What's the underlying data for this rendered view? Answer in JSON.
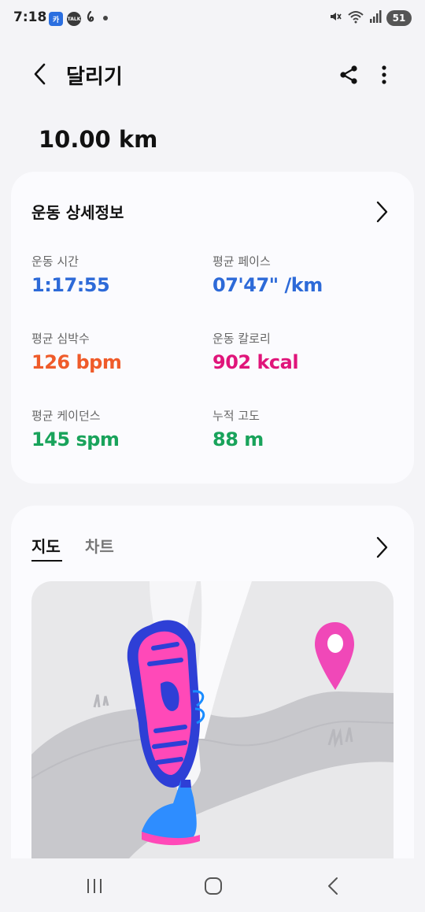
{
  "status_bar": {
    "time": "7:18",
    "notification_icons": [
      "kakao-page-icon",
      "kakaotalk-icon",
      "app-icon",
      "dot-icon"
    ],
    "kakao_page_label": "카",
    "kakaotalk_label": "TALK",
    "battery_level": "51",
    "right_icons": [
      "mute-icon",
      "wifi-icon",
      "signal-icon",
      "battery-icon"
    ]
  },
  "header": {
    "title": "달리기",
    "back_icon": "back-arrow-icon",
    "share_icon": "share-icon",
    "more_icon": "more-vertical-icon"
  },
  "summary": {
    "distance": "10.00 km"
  },
  "details": {
    "title": "운동 상세정보",
    "metrics": [
      {
        "label": "운동 시간",
        "value": "1:17:55",
        "color": "#2d6ad8"
      },
      {
        "label": "평균 페이스",
        "value": "07'47\" /km",
        "color": "#2d6ad8"
      },
      {
        "label": "평균 심박수",
        "value": "126 bpm",
        "color": "#ef5b2a"
      },
      {
        "label": "운동 칼로리",
        "value": "902 kcal",
        "color": "#e0157a"
      },
      {
        "label": "평균 케이던스",
        "value": "145 spm",
        "color": "#19a35b"
      },
      {
        "label": "누적 고도",
        "value": "88 m",
        "color": "#19a35b"
      }
    ]
  },
  "map_section": {
    "tabs": [
      {
        "label": "지도",
        "selected": true
      },
      {
        "label": "차트",
        "selected": false
      }
    ],
    "illustration": "running-shoe-illustration",
    "pin_color": "#f048b8"
  },
  "nav_bar": {
    "buttons": [
      "recent-apps-icon",
      "home-icon",
      "back-nav-icon"
    ]
  }
}
